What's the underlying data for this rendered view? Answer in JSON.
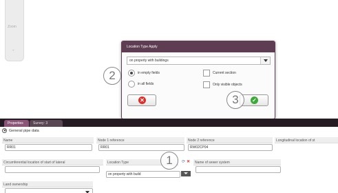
{
  "map": {
    "zoom_label": "Zoom",
    "zoom_minus": "-"
  },
  "dialog": {
    "title": "Location Type Apply",
    "selected": "on property with buildings",
    "radio_empty": "in empty fields",
    "radio_all": "in all fields",
    "chk_current": "Current section",
    "chk_visible": "Only visible objects"
  },
  "markers": {
    "one": "1",
    "two": "2",
    "three": "3"
  },
  "tabs": {
    "properties": "Properties",
    "survey": "Survey: 3"
  },
  "panel": {
    "section": "General pipe data",
    "headers": {
      "name": "Name",
      "node1": "Node 1 reference",
      "node2": "Node 2 reference",
      "long_loc": "Longitudinal location of st",
      "circ_loc": "Circumferential location of start of lateral",
      "location_type": "Location Type",
      "sewer_system": "Name of sewer system",
      "land": "Land ownership"
    },
    "values": {
      "name": "RR01",
      "node1": "RR01",
      "node2": "RW02CP04",
      "location_type": "on property with build"
    }
  }
}
